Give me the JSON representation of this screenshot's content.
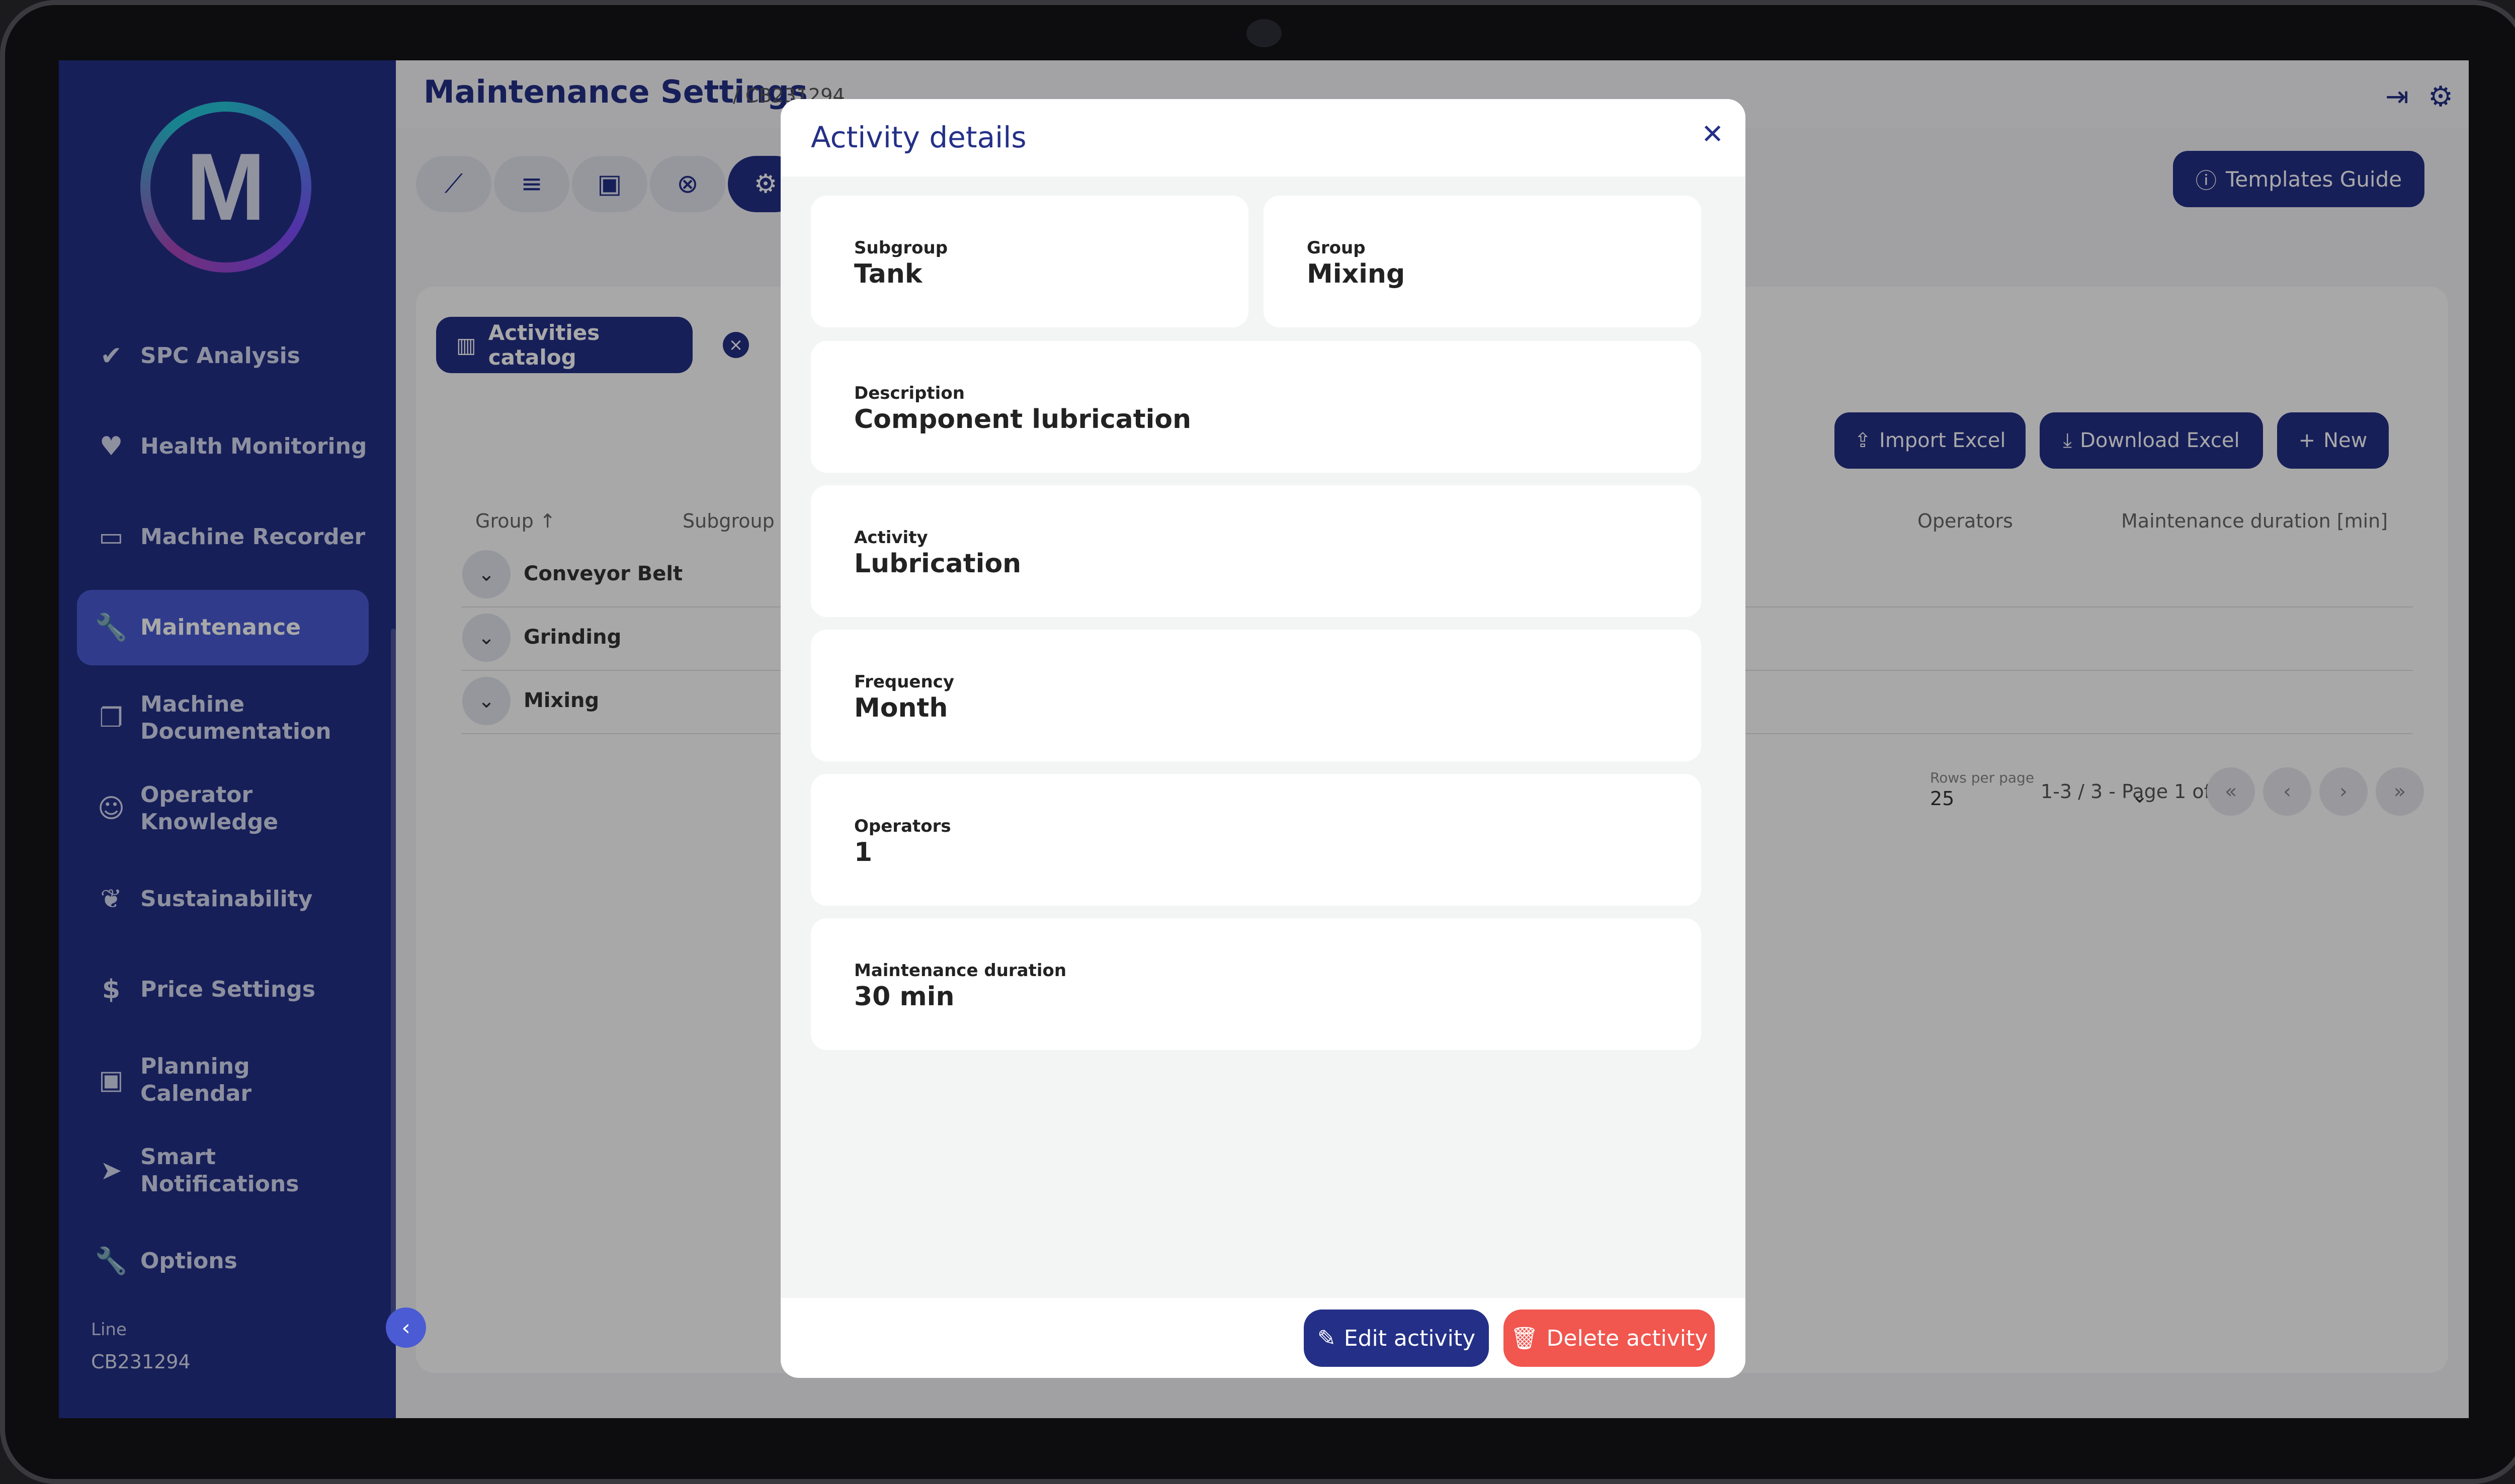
{
  "sidebar": {
    "logo_letter": "M",
    "items": [
      {
        "label": "SPC Analysis",
        "icon": "check-icon"
      },
      {
        "label": "Health Monitoring",
        "icon": "heart-icon"
      },
      {
        "label": "Machine Recorder",
        "icon": "recorder-icon"
      },
      {
        "label": "Maintenance",
        "icon": "wrench-icon"
      },
      {
        "label": "Machine Documentation",
        "icon": "document-icon"
      },
      {
        "label": "Operator Knowledge",
        "icon": "knowledge-icon"
      },
      {
        "label": "Sustainability",
        "icon": "leaf-icon"
      },
      {
        "label": "Price Settings",
        "icon": "dollar-icon"
      },
      {
        "label": "Planning Calendar",
        "icon": "calendar-icon"
      },
      {
        "label": "Smart Notifications",
        "icon": "send-icon"
      },
      {
        "label": "Options",
        "icon": "wrench-icon"
      }
    ],
    "active": "Maintenance",
    "line_label": "Line",
    "line_value": "CB231294"
  },
  "header": {
    "title": "Maintenance Settings",
    "breadcrumb": "/ CB231294",
    "templates_guide": "Templates Guide"
  },
  "catalog": {
    "tab_label": "Activities catalog",
    "import_label": "Import Excel",
    "download_label": "Download Excel",
    "new_label": "New",
    "columns": [
      "Group ↑",
      "Subgroup",
      "Operators",
      "Maintenance duration [min]"
    ],
    "rows": [
      "Conveyor Belt",
      "Grinding",
      "Mixing"
    ],
    "rows_per_page_label": "Rows per page",
    "rows_per_page_value": "25",
    "pagination": "1-3 / 3 - Page 1 of 1"
  },
  "modal": {
    "title": "Activity details",
    "fields": {
      "subgroup": {
        "label": "Subgroup",
        "value": "Tank"
      },
      "group": {
        "label": "Group",
        "value": "Mixing"
      },
      "description": {
        "label": "Description",
        "value": "Component lubrication"
      },
      "activity": {
        "label": "Activity",
        "value": "Lubrication"
      },
      "frequency": {
        "label": "Frequency",
        "value": "Month"
      },
      "operators": {
        "label": "Operators",
        "value": "1"
      },
      "duration": {
        "label": "Maintenance duration",
        "value": "30 min"
      }
    },
    "edit_label": "Edit activity",
    "delete_label": "Delete activity"
  },
  "colors": {
    "primary": "#243087",
    "accent": "#4a5bd4",
    "danger": "#f1564f"
  }
}
